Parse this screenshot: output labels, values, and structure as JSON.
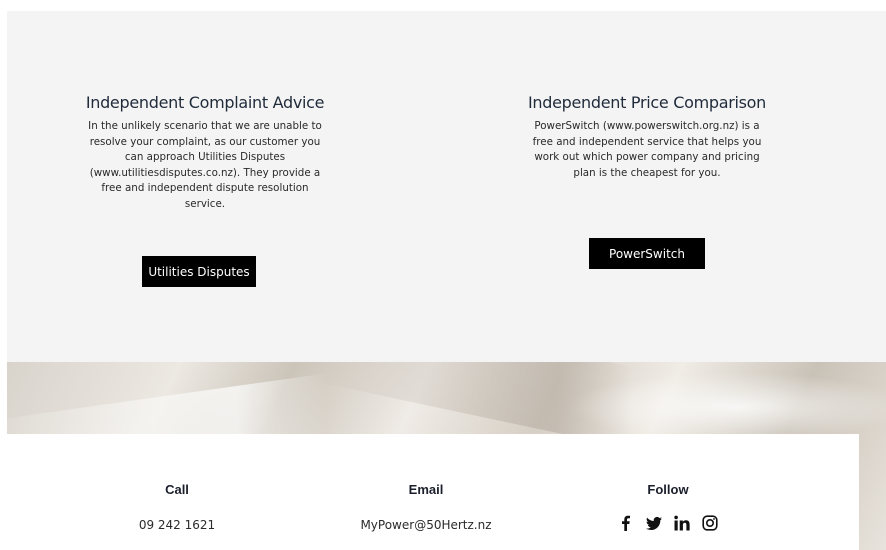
{
  "complaint": {
    "title": "Independent Complaint Advice",
    "text": "In the unlikely scenario that we are unable to resolve your complaint, as our customer you can approach Utilities Disputes (www.utilitiesdisputes.co.nz). They provide a free and independent dispute resolution service.",
    "button_label": "Utilities Disputes"
  },
  "price": {
    "title": "Independent Price Comparison",
    "text": "PowerSwitch (www.powerswitch.org.nz) is a free and independent service that helps you work out which power company and pricing plan is the cheapest for you.",
    "button_label": "PowerSwitch"
  },
  "contact": {
    "call_heading": "Call",
    "call_value": "09 242 1621",
    "email_heading": "Email",
    "email_value": "MyPower@50Hertz.nz",
    "follow_heading": "Follow",
    "social_icons": [
      "facebook-icon",
      "twitter-icon",
      "linkedin-icon",
      "instagram-icon"
    ]
  }
}
